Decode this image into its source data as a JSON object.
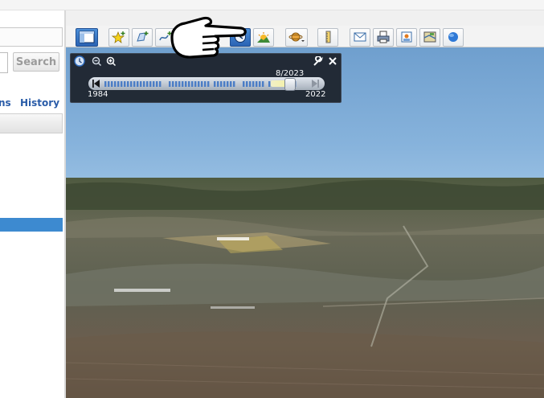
{
  "sidebar": {
    "search_button_label": "Search",
    "tab_places_label": "ns",
    "tab_history_label": "History"
  },
  "toolbar": {
    "items": [
      "hide-sidebar",
      "add-placemark",
      "add-polygon",
      "add-path",
      "add-image-overlay",
      "record-tour",
      "historical-imagery",
      "sunlight",
      "switch-planet",
      "ruler",
      "email",
      "print",
      "save-image",
      "view-in-maps",
      "web"
    ],
    "active_item": "historical-imagery"
  },
  "time_slider": {
    "current_date": "8/2023",
    "range_start": "1984",
    "range_end": "2022",
    "position_fraction": 0.92
  },
  "colors": {
    "selection_blue": "#3d8ad0",
    "tab_link": "#2a5ca8",
    "panel_bg": "#1f2630"
  }
}
